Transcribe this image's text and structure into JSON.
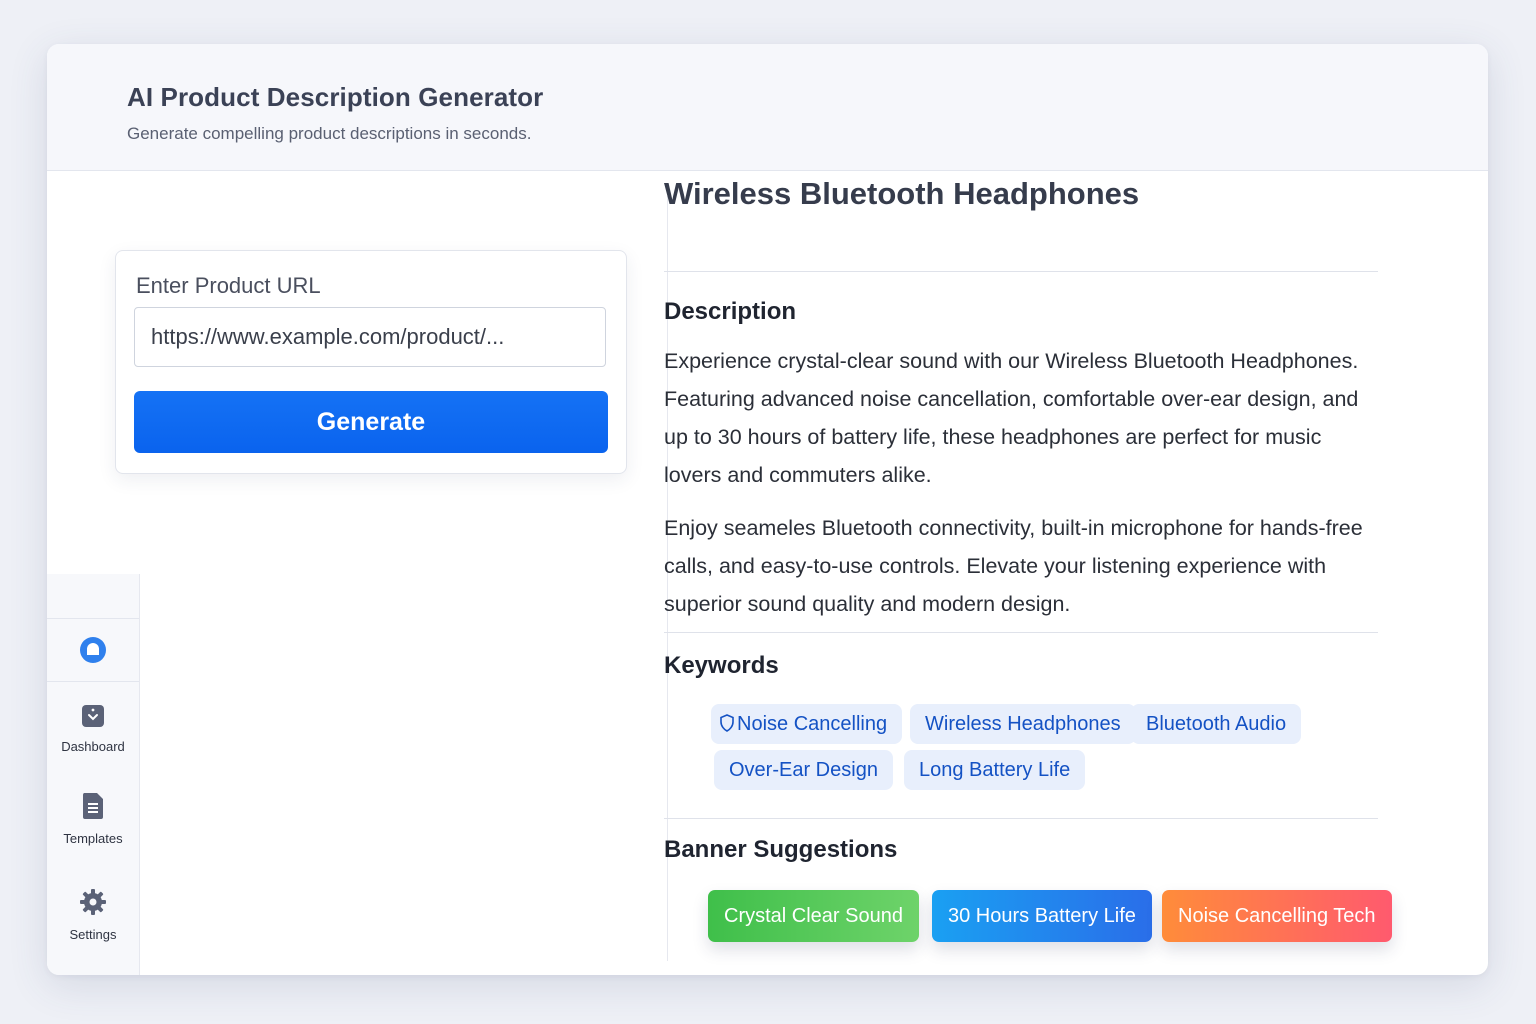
{
  "header": {
    "title": "AI Product Description Generator",
    "subtitle": "Generate compelling product descriptions in seconds."
  },
  "form": {
    "label": "Enter Product URL",
    "url_value": "https://www.example.com/product/...",
    "generate_label": "Generate"
  },
  "sidebar": {
    "items": [
      {
        "label": "Dashboard",
        "icon": "dashboard-icon"
      },
      {
        "label": "Templates",
        "icon": "document-icon"
      },
      {
        "label": "Settings",
        "icon": "gear-icon"
      }
    ]
  },
  "product": {
    "title": "Wireless Bluetooth Headphones",
    "description_heading": "Description",
    "description_p1": "Experience crystal-clear sound with our Wireless Bluetooth Headphones. Featuring advanced noise cancellation, comfortable over-ear design, and up to 30 hours of battery life, these headphones are perfect for music lovers and commuters alike.",
    "description_p2": "Enjoy seameles Bluetooth connectivity, built-in microphone for hands-free calls, and easy-to-use controls. Elevate your listening experience with superior sound quality and modern design.",
    "keywords_heading": "Keywords",
    "keywords": [
      "Noise Cancelling",
      "Wireless Headphones",
      "Bluetooth Audio",
      "Over-Ear Design",
      "Long Battery Life"
    ],
    "banners_heading": "Banner Suggestions",
    "banners": [
      "Crystal Clear Sound",
      "30 Hours Battery Life",
      "Noise Cancelling Tech"
    ]
  },
  "colors": {
    "primary": "#0a63ee",
    "keyword_bg": "#e8effc",
    "keyword_text": "#1452c4",
    "banner_green": "#4cc64a",
    "banner_blue": "#1a8ff0",
    "banner_orange": "#ff7a45"
  }
}
